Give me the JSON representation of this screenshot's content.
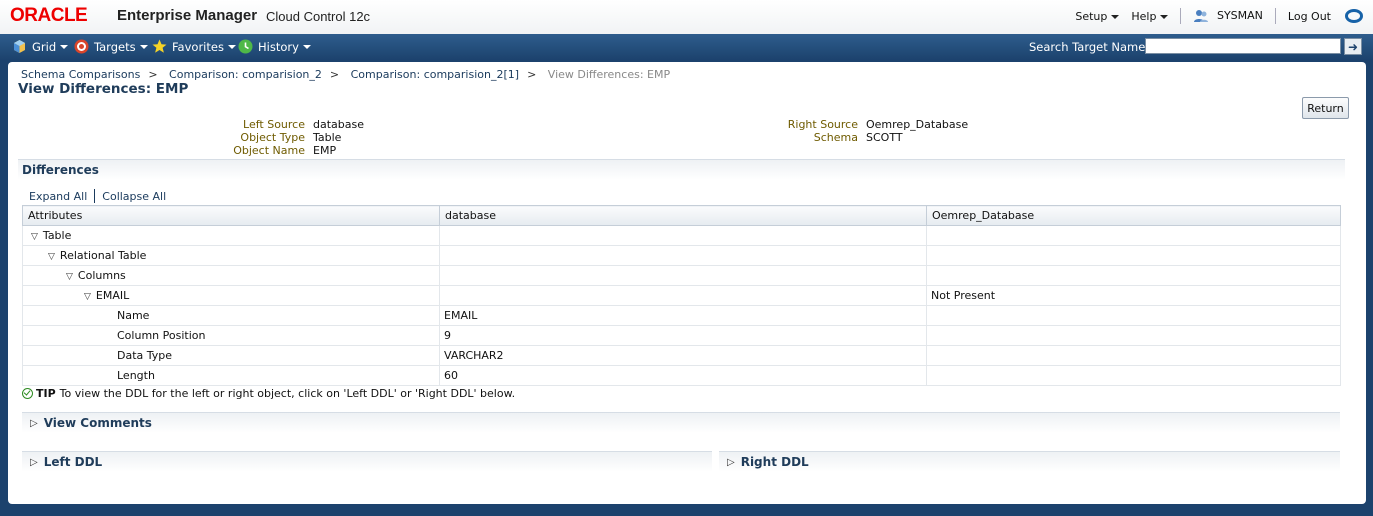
{
  "header": {
    "oracle": "ORACLE",
    "product": "Enterprise Manager",
    "edition": "Cloud Control 12c",
    "setup": "Setup",
    "help": "Help",
    "user": "SYSMAN",
    "logout": "Log Out"
  },
  "nav": {
    "grid": "Grid",
    "targets": "Targets",
    "favorites": "Favorites",
    "history": "History",
    "search_label": "Search Target Name",
    "search_value": ""
  },
  "breadcrumb": {
    "items": [
      "Schema Comparisons",
      "Comparison: comparision_2",
      "Comparison: comparision_2[1]"
    ],
    "current": "View Differences: EMP"
  },
  "page": {
    "title": "View Differences: EMP",
    "return_label": "Return"
  },
  "info": {
    "left_source_label": "Left Source",
    "left_source": "database",
    "object_type_label": "Object Type",
    "object_type": "Table",
    "object_name_label": "Object Name",
    "object_name": "EMP",
    "right_source_label": "Right Source",
    "right_source": "Oemrep_Database",
    "schema_label": "Schema",
    "schema": "SCOTT"
  },
  "differences": {
    "title": "Differences",
    "expand_all": "Expand All",
    "collapse_all": "Collapse All",
    "columns": [
      "Attributes",
      "database",
      "Oemrep_Database"
    ],
    "rows": [
      {
        "attr": "Table",
        "left": "",
        "right": ""
      },
      {
        "attr": "Relational Table",
        "left": "",
        "right": ""
      },
      {
        "attr": "Columns",
        "left": "",
        "right": ""
      },
      {
        "attr": "EMAIL",
        "left": "",
        "right": "Not Present"
      },
      {
        "attr": "Name",
        "left": "EMAIL",
        "right": ""
      },
      {
        "attr": "Column Position",
        "left": "9",
        "right": ""
      },
      {
        "attr": "Data Type",
        "left": "VARCHAR2",
        "right": ""
      },
      {
        "attr": "Length",
        "left": "60",
        "right": ""
      }
    ]
  },
  "tip": {
    "label": "TIP",
    "text": "To view the DDL for the left or right object, click on 'Left DDL' or 'Right DDL' below."
  },
  "sections": {
    "view_comments": "View Comments",
    "left_ddl": "Left DDL",
    "right_ddl": "Right DDL"
  }
}
